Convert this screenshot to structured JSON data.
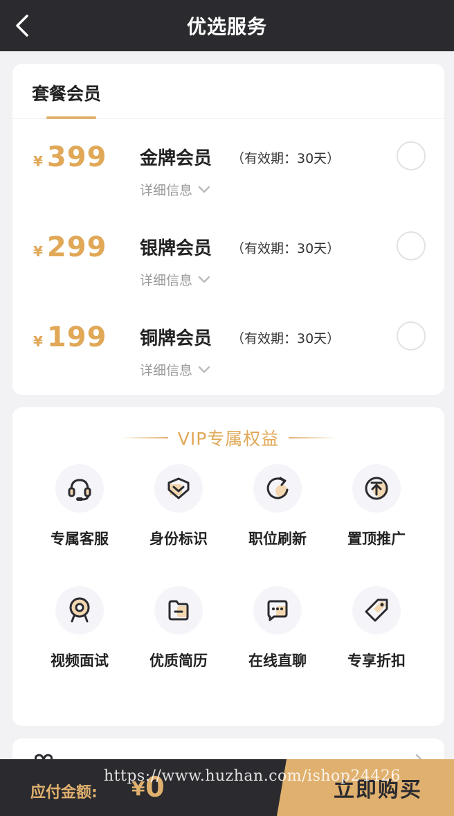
{
  "header": {
    "title": "优选服务"
  },
  "plans": {
    "title": "套餐会员",
    "currency": "¥",
    "items": [
      {
        "price": "399",
        "name": "金牌会员",
        "validity": "（有效期：30天）",
        "detail": "详细信息"
      },
      {
        "price": "299",
        "name": "银牌会员",
        "validity": "（有效期：30天）",
        "detail": "详细信息"
      },
      {
        "price": "199",
        "name": "铜牌会员",
        "validity": "（有效期：30天）",
        "detail": "详细信息"
      }
    ]
  },
  "benefits": {
    "title": "VIP专属权益",
    "items": [
      {
        "label": "专属客服",
        "icon": "headset-icon"
      },
      {
        "label": "身份标识",
        "icon": "badge-icon"
      },
      {
        "label": "职位刷新",
        "icon": "refresh-icon"
      },
      {
        "label": "置顶推广",
        "icon": "pin-top-icon"
      },
      {
        "label": "视频面试",
        "icon": "webcam-icon"
      },
      {
        "label": "优质简历",
        "icon": "folder-icon"
      },
      {
        "label": "在线直聊",
        "icon": "chat-icon"
      },
      {
        "label": "专享折扣",
        "icon": "tag-icon"
      }
    ]
  },
  "footer": {
    "pay_label": "应付金额:",
    "currency": "¥",
    "amount": "0",
    "buy_label": "立即购买"
  },
  "watermark": "https://www.huzhan.com/ishop24426",
  "colors": {
    "accent": "#e0b06e",
    "dark": "#2b2b2f",
    "price": "#e0a857"
  }
}
